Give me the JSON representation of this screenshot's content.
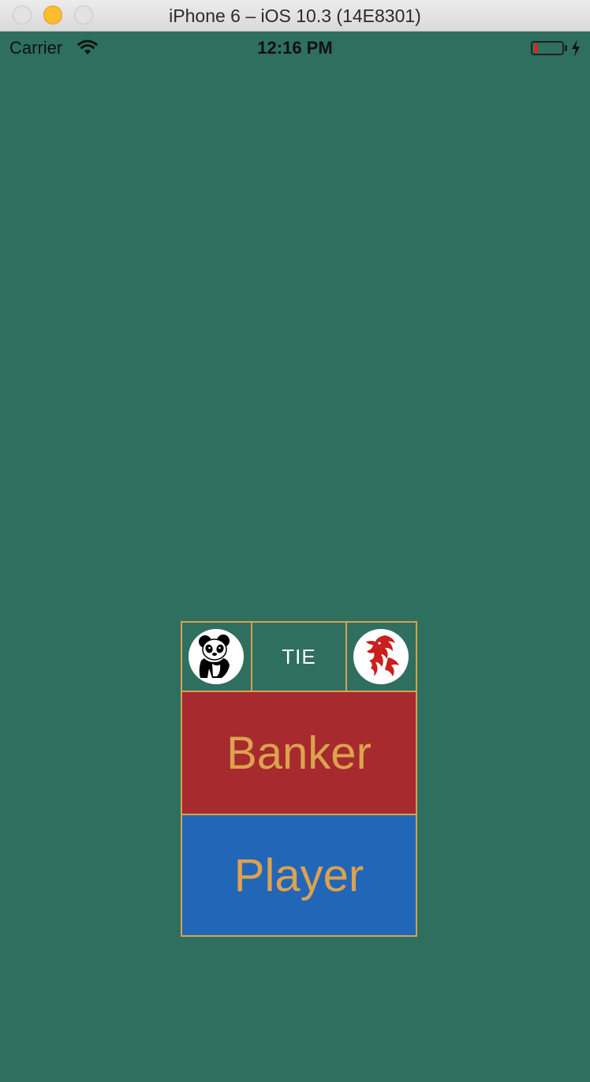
{
  "window": {
    "title": "iPhone 6 – iOS 10.3 (14E8301)"
  },
  "status_bar": {
    "carrier": "Carrier",
    "time": "12:16 PM",
    "battery_level": 0.15,
    "battery_color": "#e0281f"
  },
  "board": {
    "panda": {
      "icon": "panda-icon"
    },
    "tie": {
      "label": "TIE"
    },
    "dragon": {
      "icon": "dragon-icon",
      "color": "#c81f1f"
    },
    "banker": {
      "label": "Banker",
      "color": "#a62a2e"
    },
    "player": {
      "label": "Player",
      "color": "#2266b8"
    },
    "label_color": "#dca24f",
    "border_color": "#d8a14f",
    "background": "#2e6f60"
  }
}
